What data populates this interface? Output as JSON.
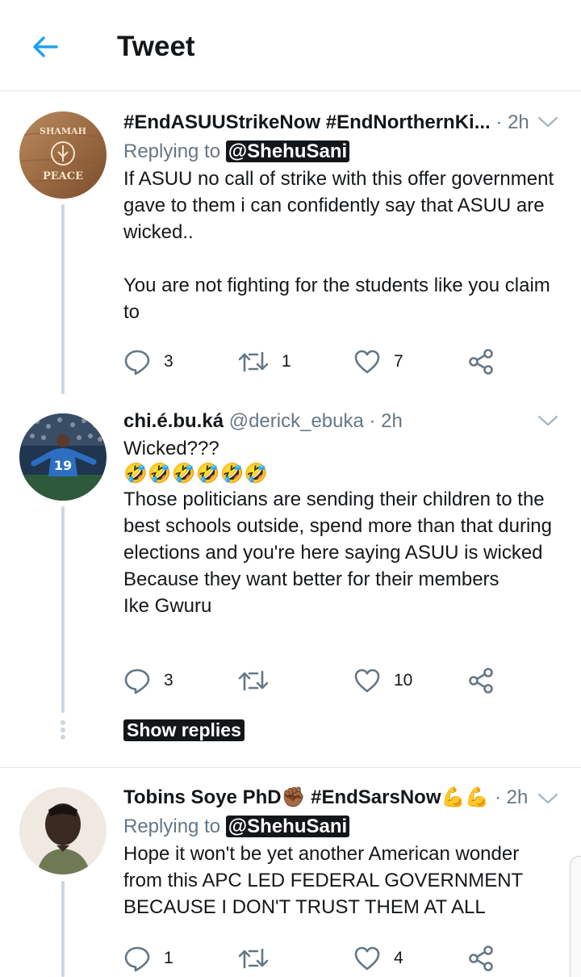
{
  "header": {
    "title": "Tweet"
  },
  "tweets": [
    {
      "name": "#EndASUUStrikeNow #EndNorthernKi...",
      "handle": "",
      "time": "· 2h",
      "reply_prefix": "Replying to",
      "reply_to": "@ShehuSani",
      "text": "If ASUU no call of strike with this offer government gave to them i can confidently say that ASUU are wicked..\n\nYou are not fighting for the students like you claim to",
      "replies": "3",
      "retweets": "1",
      "likes": "7",
      "avatar_text_top": "SHAMAH",
      "avatar_text_bottom": "PEACE"
    },
    {
      "name": "chi.é.bu.ká",
      "handle": "@derick_ebuka",
      "time": "· 2h",
      "first_line": "Wicked???",
      "emojis": "🤣🤣🤣🤣🤣🤣",
      "text": "Those politicians are sending their children to the best schools outside, spend more than that during elections and you're here saying ASUU is wicked\nBecause they want better for their members\nIke Gwuru",
      "replies": "3",
      "retweets": "",
      "likes": "10",
      "avatar_number": "19"
    },
    {
      "name": "Tobins Soye PhD✊🏾 #EndSarsNow💪💪",
      "handle": "",
      "time": "· 2h",
      "reply_prefix": "Replying to",
      "reply_to": "@ShehuSani",
      "text": "Hope it won't be yet another American wonder from this APC LED FEDERAL GOVERNMENT BECAUSE I DON'T TRUST THEM AT ALL",
      "replies": "1",
      "retweets": "",
      "likes": "4"
    }
  ],
  "show_replies": "Show replies",
  "colors": {
    "accent": "#1da1f2",
    "icon": "#657786",
    "text": "#14171a",
    "divider": "#e1e8ed"
  }
}
